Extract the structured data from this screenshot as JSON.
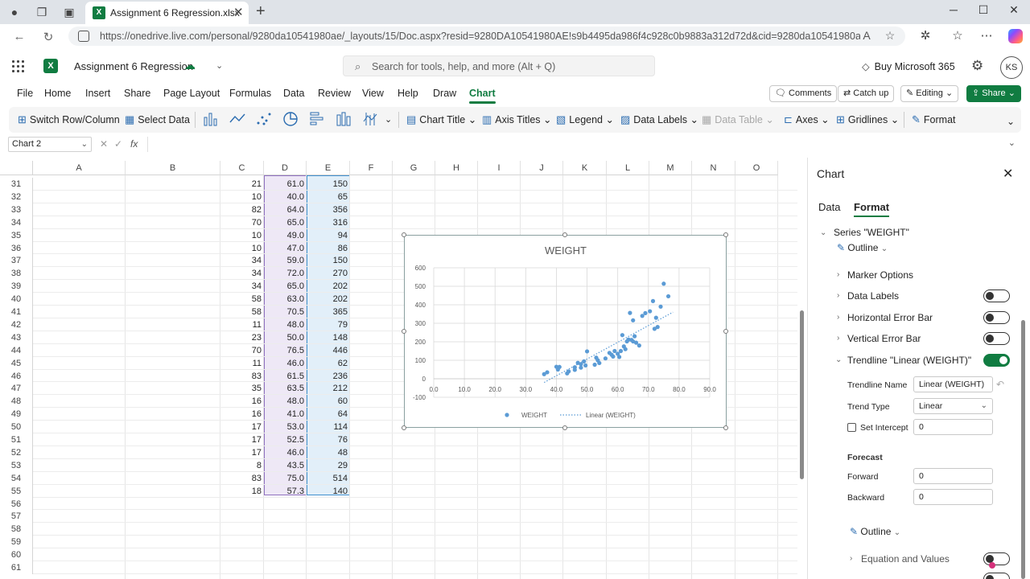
{
  "browser": {
    "tab_title": "Assignment 6 Regression.xlsx",
    "url": "https://onedrive.live.com/personal/9280da10541980ae/_layouts/15/Doc.aspx?resid=9280DA10541980AE!s9b4495da986f4c928c0b9883a312d72d&cid=9280da10541980ae&migra..."
  },
  "app": {
    "doc_name": "Assignment 6 Regression",
    "search_placeholder": "Search for tools, help, and more (Alt + Q)",
    "buy_label": "Buy Microsoft 365",
    "avatar_initials": "KS",
    "menu_tabs": [
      "File",
      "Home",
      "Insert",
      "Share",
      "Page Layout",
      "Formulas",
      "Data",
      "Review",
      "View",
      "Help",
      "Draw",
      "Chart"
    ],
    "active_tab": "Chart",
    "comments_label": "Comments",
    "catchup_label": "Catch up",
    "editing_label": "Editing",
    "share_label": "Share"
  },
  "toolbar": {
    "switch_label": "Switch Row/Column",
    "select_data_label": "Select Data",
    "chart_title_label": "Chart Title",
    "axis_titles_label": "Axis Titles",
    "legend_label": "Legend",
    "data_labels_label": "Data Labels",
    "data_table_label": "Data Table",
    "axes_label": "Axes",
    "gridlines_label": "Gridlines",
    "format_label": "Format"
  },
  "formula_bar": {
    "name_box": "Chart 2",
    "fx": "fx"
  },
  "grid": {
    "columns": [
      "A",
      "B",
      "C",
      "D",
      "E",
      "F",
      "G",
      "H",
      "I",
      "J",
      "K",
      "L",
      "M",
      "N",
      "O"
    ],
    "rows": [
      {
        "r": "31",
        "c": "21",
        "d": "61.0",
        "e": "150"
      },
      {
        "r": "32",
        "c": "10",
        "d": "40.0",
        "e": "65"
      },
      {
        "r": "33",
        "c": "82",
        "d": "64.0",
        "e": "356"
      },
      {
        "r": "34",
        "c": "70",
        "d": "65.0",
        "e": "316"
      },
      {
        "r": "35",
        "c": "10",
        "d": "49.0",
        "e": "94"
      },
      {
        "r": "36",
        "c": "10",
        "d": "47.0",
        "e": "86"
      },
      {
        "r": "37",
        "c": "34",
        "d": "59.0",
        "e": "150"
      },
      {
        "r": "38",
        "c": "34",
        "d": "72.0",
        "e": "270"
      },
      {
        "r": "39",
        "c": "34",
        "d": "65.0",
        "e": "202"
      },
      {
        "r": "40",
        "c": "58",
        "d": "63.0",
        "e": "202"
      },
      {
        "r": "41",
        "c": "58",
        "d": "70.5",
        "e": "365"
      },
      {
        "r": "42",
        "c": "11",
        "d": "48.0",
        "e": "79"
      },
      {
        "r": "43",
        "c": "23",
        "d": "50.0",
        "e": "148"
      },
      {
        "r": "44",
        "c": "70",
        "d": "76.5",
        "e": "446"
      },
      {
        "r": "45",
        "c": "11",
        "d": "46.0",
        "e": "62"
      },
      {
        "r": "46",
        "c": "83",
        "d": "61.5",
        "e": "236"
      },
      {
        "r": "47",
        "c": "35",
        "d": "63.5",
        "e": "212"
      },
      {
        "r": "48",
        "c": "16",
        "d": "48.0",
        "e": "60"
      },
      {
        "r": "49",
        "c": "16",
        "d": "41.0",
        "e": "64"
      },
      {
        "r": "50",
        "c": "17",
        "d": "53.0",
        "e": "114"
      },
      {
        "r": "51",
        "c": "17",
        "d": "52.5",
        "e": "76"
      },
      {
        "r": "52",
        "c": "17",
        "d": "46.0",
        "e": "48"
      },
      {
        "r": "53",
        "c": "8",
        "d": "43.5",
        "e": "29"
      },
      {
        "r": "54",
        "c": "83",
        "d": "75.0",
        "e": "514"
      },
      {
        "r": "55",
        "c": "18",
        "d": "57.3",
        "e": "140"
      },
      {
        "r": "56",
        "c": "",
        "d": "",
        "e": ""
      },
      {
        "r": "57",
        "c": "",
        "d": "",
        "e": ""
      },
      {
        "r": "58",
        "c": "",
        "d": "",
        "e": ""
      },
      {
        "r": "59",
        "c": "",
        "d": "",
        "e": ""
      },
      {
        "r": "60",
        "c": "",
        "d": "",
        "e": ""
      },
      {
        "r": "61",
        "c": "",
        "d": "",
        "e": ""
      }
    ]
  },
  "chart_data": {
    "type": "scatter",
    "title": "WEIGHT",
    "xlim": [
      0,
      90
    ],
    "ylim": [
      -100,
      600
    ],
    "x_ticks": [
      "0.0",
      "10.0",
      "20.0",
      "30.0",
      "40.0",
      "50.0",
      "60.0",
      "70.0",
      "80.0",
      "90.0"
    ],
    "y_ticks": [
      "600",
      "500",
      "400",
      "300",
      "200",
      "100",
      "0",
      "-100"
    ],
    "grid": true,
    "legend_position": "bottom",
    "series": [
      {
        "name": "WEIGHT",
        "color": "#5b9bd5",
        "points": [
          [
            61.0,
            150
          ],
          [
            40.0,
            65
          ],
          [
            64.0,
            356
          ],
          [
            65.0,
            316
          ],
          [
            49.0,
            94
          ],
          [
            47.0,
            86
          ],
          [
            59.0,
            150
          ],
          [
            72.0,
            270
          ],
          [
            65.0,
            202
          ],
          [
            63.0,
            202
          ],
          [
            70.5,
            365
          ],
          [
            48.0,
            79
          ],
          [
            50.0,
            148
          ],
          [
            76.5,
            446
          ],
          [
            46.0,
            62
          ],
          [
            61.5,
            236
          ],
          [
            63.5,
            212
          ],
          [
            48.0,
            60
          ],
          [
            41.0,
            64
          ],
          [
            53.0,
            114
          ],
          [
            52.5,
            76
          ],
          [
            46.0,
            48
          ],
          [
            43.5,
            29
          ],
          [
            75.0,
            514
          ],
          [
            57.3,
            140
          ],
          [
            36.0,
            25
          ],
          [
            37.0,
            35
          ],
          [
            40.5,
            50
          ],
          [
            44.0,
            40
          ],
          [
            49.5,
            72
          ],
          [
            53.5,
            100
          ],
          [
            54.0,
            85
          ],
          [
            58.0,
            130
          ],
          [
            58.5,
            120
          ],
          [
            60.0,
            135
          ],
          [
            60.5,
            118
          ],
          [
            62.0,
            175
          ],
          [
            64.5,
            210
          ],
          [
            66.0,
            195
          ],
          [
            67.0,
            180
          ],
          [
            68.0,
            340
          ],
          [
            69.0,
            355
          ],
          [
            71.5,
            420
          ],
          [
            72.5,
            330
          ],
          [
            73.0,
            280
          ],
          [
            74.0,
            390
          ],
          [
            56.0,
            110
          ],
          [
            62.5,
            160
          ],
          [
            65.5,
            230
          ]
        ]
      },
      {
        "name": "Linear (WEIGHT)",
        "color": "#5b9bd5",
        "style": "dotted",
        "line": [
          [
            36.0,
            -20
          ],
          [
            78.0,
            360
          ]
        ]
      }
    ]
  },
  "pane": {
    "title": "Chart",
    "tab_data": "Data",
    "tab_format": "Format",
    "series_header": "Series \"WEIGHT\"",
    "outline_label": "Outline",
    "marker_options": "Marker Options",
    "data_labels": "Data Labels",
    "horizontal_error_bar": "Horizontal Error Bar",
    "vertical_error_bar": "Vertical Error Bar",
    "trendline_header": "Trendline \"Linear (WEIGHT)\"",
    "trendline_name_label": "Trendline Name",
    "trendline_name_value": "Linear (WEIGHT)",
    "trend_type_label": "Trend Type",
    "trend_type_value": "Linear",
    "set_intercept_label": "Set Intercept",
    "set_intercept_value": "0",
    "forecast_label": "Forecast",
    "forward_label": "Forward",
    "forward_value": "0",
    "backward_label": "Backward",
    "backward_value": "0",
    "outline2_label": "Outline",
    "equation_label": "Equation and Values",
    "toggles": {
      "data_labels": false,
      "horizontal_error_bar": false,
      "vertical_error_bar": false,
      "trendline": true,
      "equation": false
    }
  }
}
